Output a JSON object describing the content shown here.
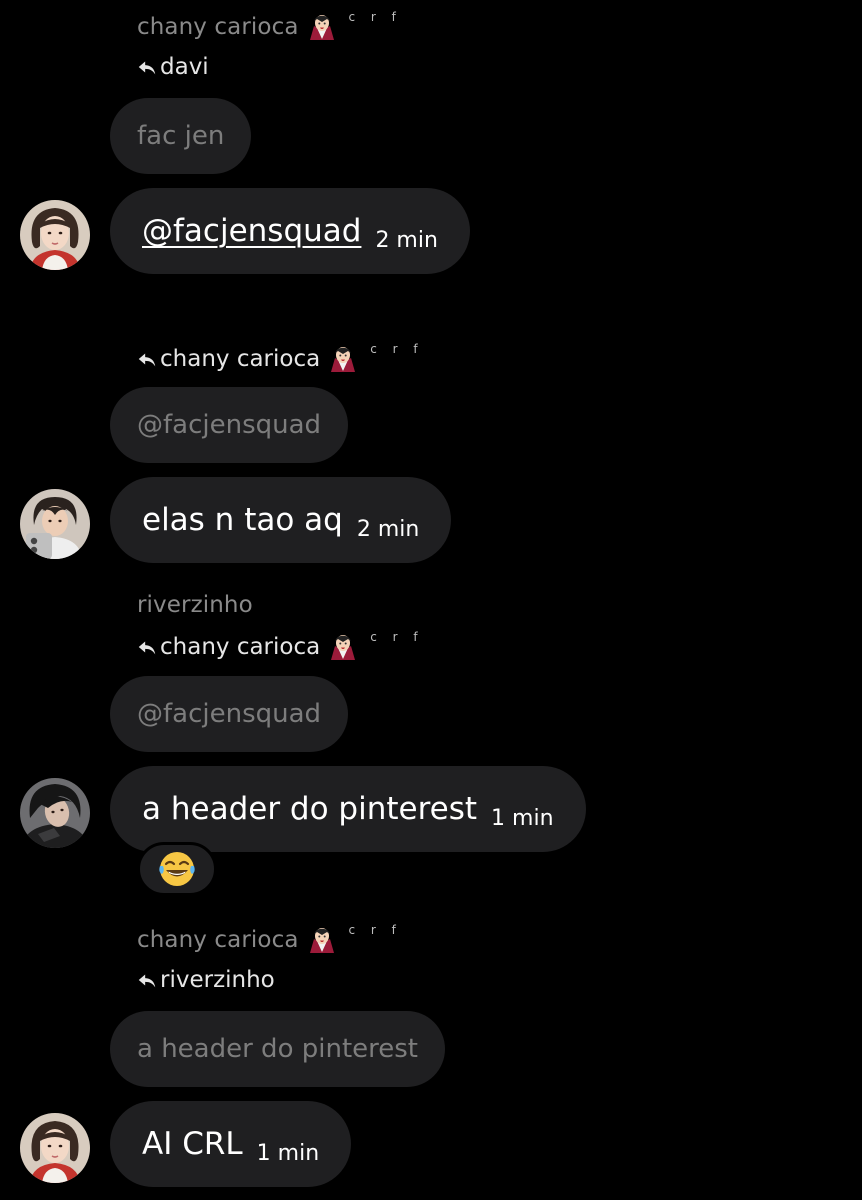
{
  "messages": [
    {
      "sender": "chany carioca",
      "sender_tag": "c r f",
      "reply_to": "davi",
      "quoted": "fac jen",
      "text": "@facjensquad",
      "time": "2 min",
      "avatar": "avatar-girl-red-shirt"
    },
    {
      "reply_to": "chany carioca",
      "reply_tag": "c r f",
      "quoted": "@facjensquad",
      "text": "elas n tao aq",
      "time": "2 min",
      "avatar": "avatar-boy-phone"
    },
    {
      "sender": "riverzinho",
      "reply_to": "chany carioca",
      "reply_tag": "c r f",
      "quoted": "@facjensquad",
      "text": "a header do pinterest",
      "time": "1 min",
      "avatar": "avatar-boy-dark",
      "reaction": "😂"
    },
    {
      "sender": "chany carioca",
      "sender_tag": "c r f",
      "reply_to": "riverzinho",
      "quoted": "a header do pinterest",
      "text": "AI CRL",
      "time": "1 min",
      "avatar": "avatar-girl-red-shirt"
    }
  ],
  "icons": {
    "reply": "reply-arrow-icon",
    "sender_emoji": "vampire-emoji-icon"
  },
  "colors": {
    "background": "#000000",
    "bubble": "#1f1f21",
    "muted_text": "#8a8a8a",
    "quoted_text": "#7d7d7d",
    "text": "#ffffff"
  }
}
